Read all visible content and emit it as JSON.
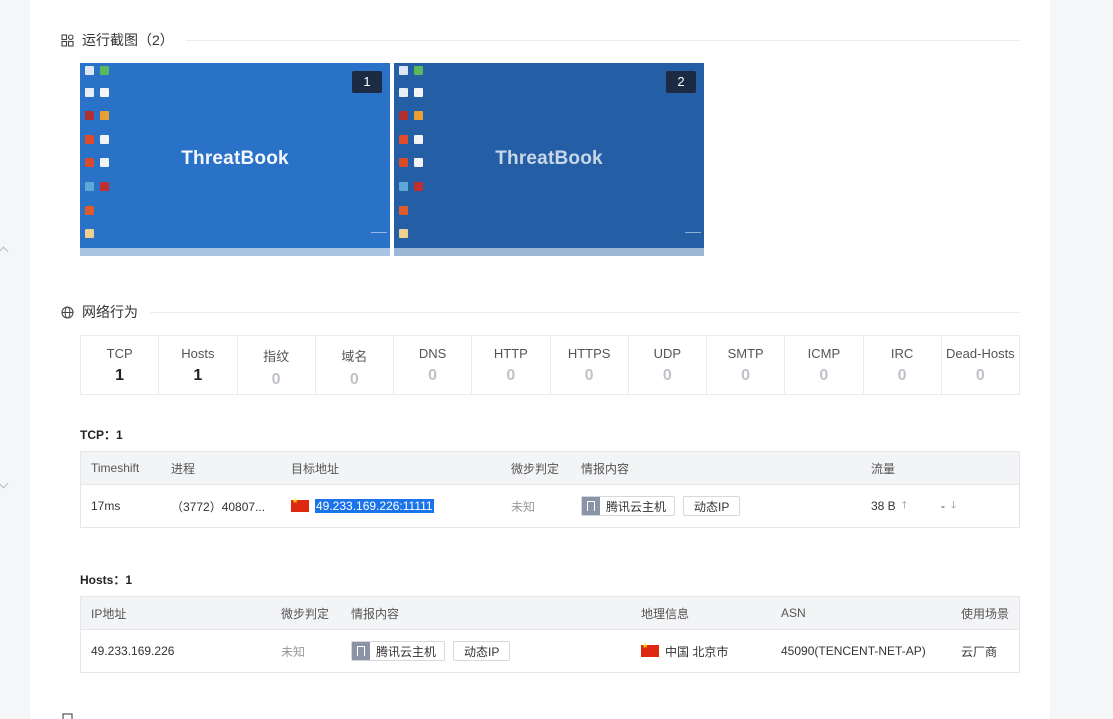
{
  "screenshots": {
    "title": "运行截图（2）",
    "icon": "screenshots-icon",
    "items": [
      {
        "badge": "1",
        "logo": "ThreatBook",
        "color": "#2a71c8"
      },
      {
        "badge": "2",
        "logo": "ThreatBook",
        "color": "#245fa5"
      }
    ]
  },
  "network": {
    "title": "网络行为",
    "icon": "globe-icon",
    "stats": [
      {
        "label": "TCP",
        "value": "1"
      },
      {
        "label": "Hosts",
        "value": "1"
      },
      {
        "label": "指纹",
        "value": "0"
      },
      {
        "label": "域名",
        "value": "0"
      },
      {
        "label": "DNS",
        "value": "0"
      },
      {
        "label": "HTTP",
        "value": "0"
      },
      {
        "label": "HTTPS",
        "value": "0"
      },
      {
        "label": "UDP",
        "value": "0"
      },
      {
        "label": "SMTP",
        "value": "0"
      },
      {
        "label": "ICMP",
        "value": "0"
      },
      {
        "label": "IRC",
        "value": "0"
      },
      {
        "label": "Dead-Hosts",
        "value": "0"
      }
    ]
  },
  "tcp": {
    "title": "TCP：1",
    "headers": {
      "timeshift": "Timeshift",
      "process": "进程",
      "target": "目标地址",
      "verdict": "微步判定",
      "intel": "情报内容",
      "traffic": "流量"
    },
    "row": {
      "timeshift": "17ms",
      "process": "（3772）40807...",
      "target": "49.233.169.226:11111",
      "verdict": "未知",
      "tag1": "腾讯云主机",
      "tag2": "动态IP",
      "up": "38 B",
      "down": "-"
    }
  },
  "hosts": {
    "title": "Hosts：1",
    "headers": {
      "ip": "IP地址",
      "verdict": "微步判定",
      "intel": "情报内容",
      "geo": "地理信息",
      "asn": "ASN",
      "usage": "使用场景"
    },
    "row": {
      "ip": "49.233.169.226",
      "verdict": "未知",
      "tag1": "腾讯云主机",
      "tag2": "动态IP",
      "country": "中国",
      "city": "北京市",
      "asn": "45090(TENCENT-NET-AP)",
      "usage": "云厂商"
    }
  }
}
